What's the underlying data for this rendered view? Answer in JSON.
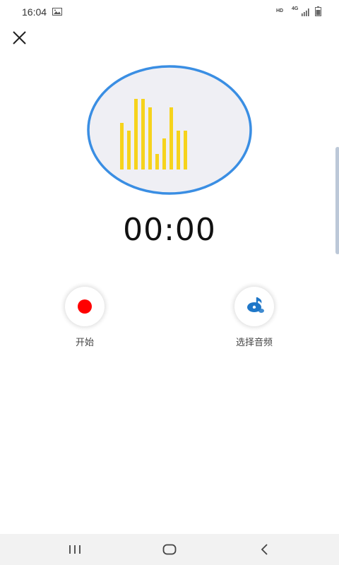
{
  "status_bar": {
    "time": "16:04",
    "hd_label": "HD",
    "network_label": "4G",
    "icons": [
      "gallery-icon",
      "signal-icon",
      "battery-icon"
    ]
  },
  "toolbar": {
    "close_icon": "close-icon"
  },
  "visualizer": {
    "bar_levels": [
      0.66,
      0.55,
      1.0,
      1.0,
      0.88,
      0.22,
      0.44,
      0.88,
      0.55,
      0.55
    ],
    "bar_color": "#f6d31c",
    "oval_fill": "#efeff4",
    "oval_border": "#3a8ee3"
  },
  "timer": {
    "value": "00:00"
  },
  "actions": {
    "start_label": "开始",
    "choose_audio_label": "选择音频",
    "record_color": "#ff0000",
    "music_color": "#1f77c8"
  },
  "nav_bar": {
    "icons": [
      "recent-apps-icon",
      "home-icon",
      "back-icon"
    ]
  }
}
